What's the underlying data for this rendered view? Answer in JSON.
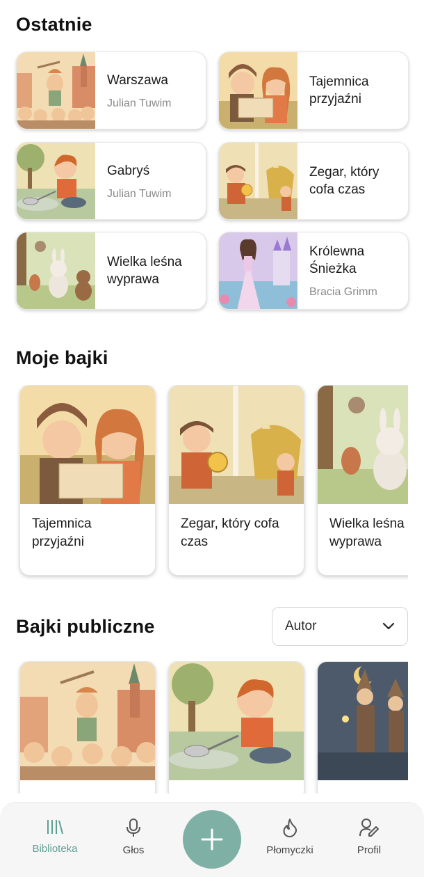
{
  "sections": {
    "recent": "Ostatnie",
    "my": "Moje bajki",
    "public": "Bajki publiczne"
  },
  "recent": [
    {
      "title": "Warszawa",
      "author": "Julian Tuwim"
    },
    {
      "title": "Tajemnica przyjaźni",
      "author": ""
    },
    {
      "title": "Gabryś",
      "author": "Julian Tuwim"
    },
    {
      "title": "Zegar, który cofa czas",
      "author": ""
    },
    {
      "title": "Wielka leśna wyprawa",
      "author": ""
    },
    {
      "title": "Królewna Śnieżka",
      "author": "Bracia Grimm"
    }
  ],
  "my_stories": [
    {
      "title": "Tajemnica przyjaźni"
    },
    {
      "title": "Zegar, który cofa czas"
    },
    {
      "title": "Wielka leśna wyprawa"
    }
  ],
  "filter": {
    "selected": "Autor",
    "icon": "chevron-down-icon"
  },
  "nav": {
    "library": "Biblioteka",
    "voice": "Głos",
    "add_icon": "plus-icon",
    "flames": "Płomyczki",
    "profile": "Profil",
    "active_color": "#5e9f92",
    "fab_color": "#7fb0a5"
  }
}
